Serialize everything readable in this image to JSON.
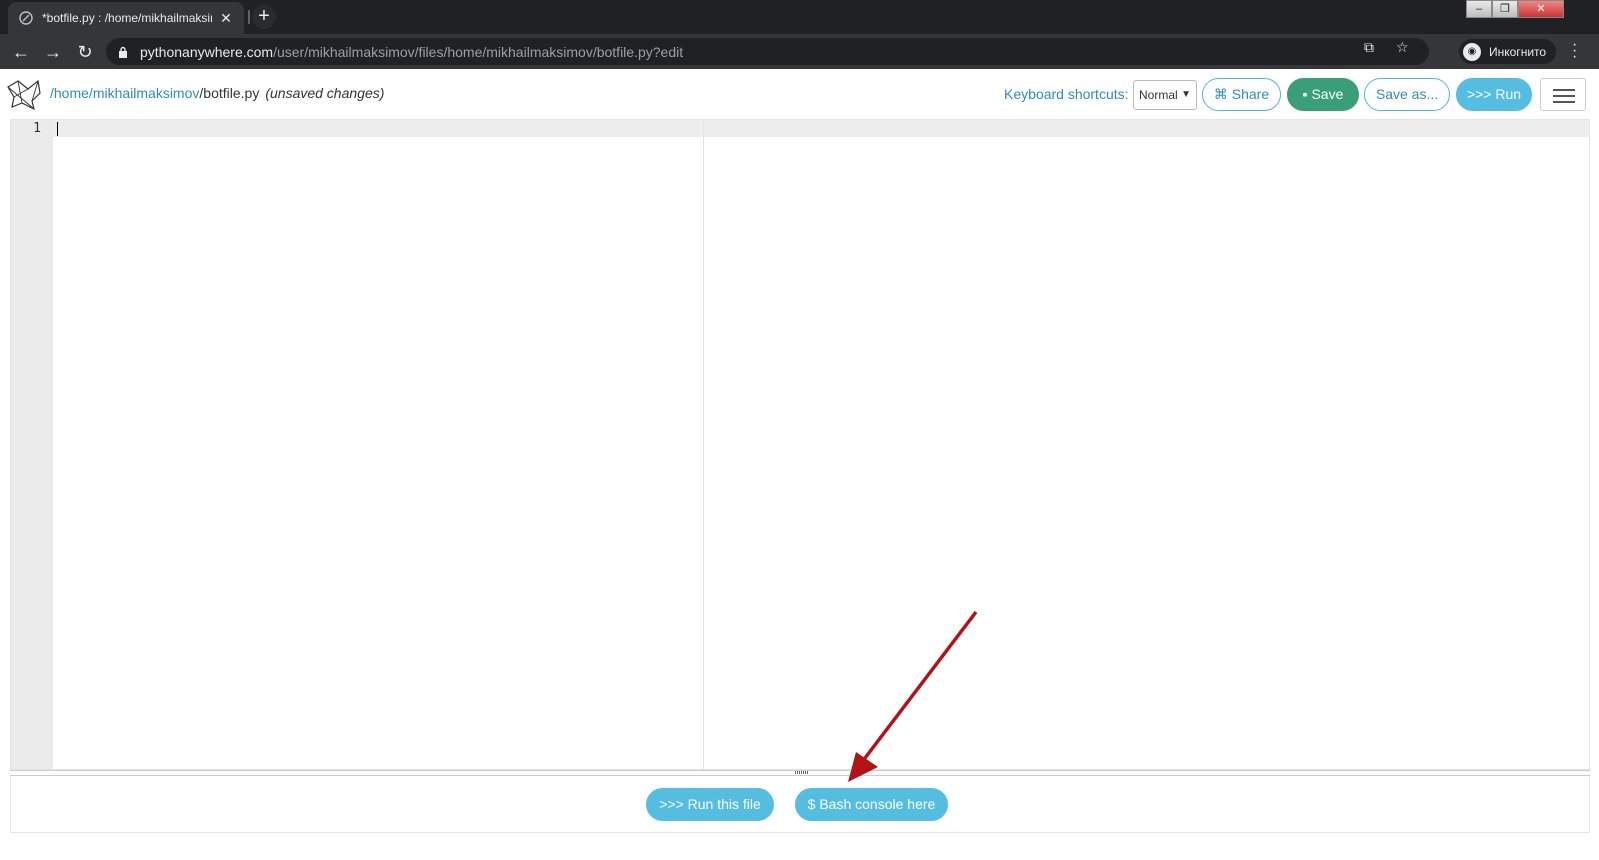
{
  "browser": {
    "tab_title": "*botfile.py : /home/mikhailmaksimov",
    "url_host": "pythonanywhere.com",
    "url_path": "/user/mikhailmaksimov/files/home/mikhailmaksimov/botfile.py?edit",
    "incognito_label": "Инкогнито"
  },
  "header": {
    "path_home": "/home/",
    "path_user": "mikhailmaksimov",
    "path_file": "/botfile.py",
    "unsaved": "(unsaved changes)",
    "keyboard_label": "Keyboard shortcuts:",
    "keyboard_mode": "Normal",
    "share": "Share",
    "save": "Save",
    "save_as": "Save as...",
    "run": ">>> Run"
  },
  "editor": {
    "line_numbers": [
      "1"
    ]
  },
  "bottom": {
    "run_file": ">>> Run this file",
    "bash_console": "$ Bash console here"
  },
  "colors": {
    "accent": "#54bde0",
    "save_green": "#3a9e78",
    "annotation_arrow": "#b31217"
  }
}
